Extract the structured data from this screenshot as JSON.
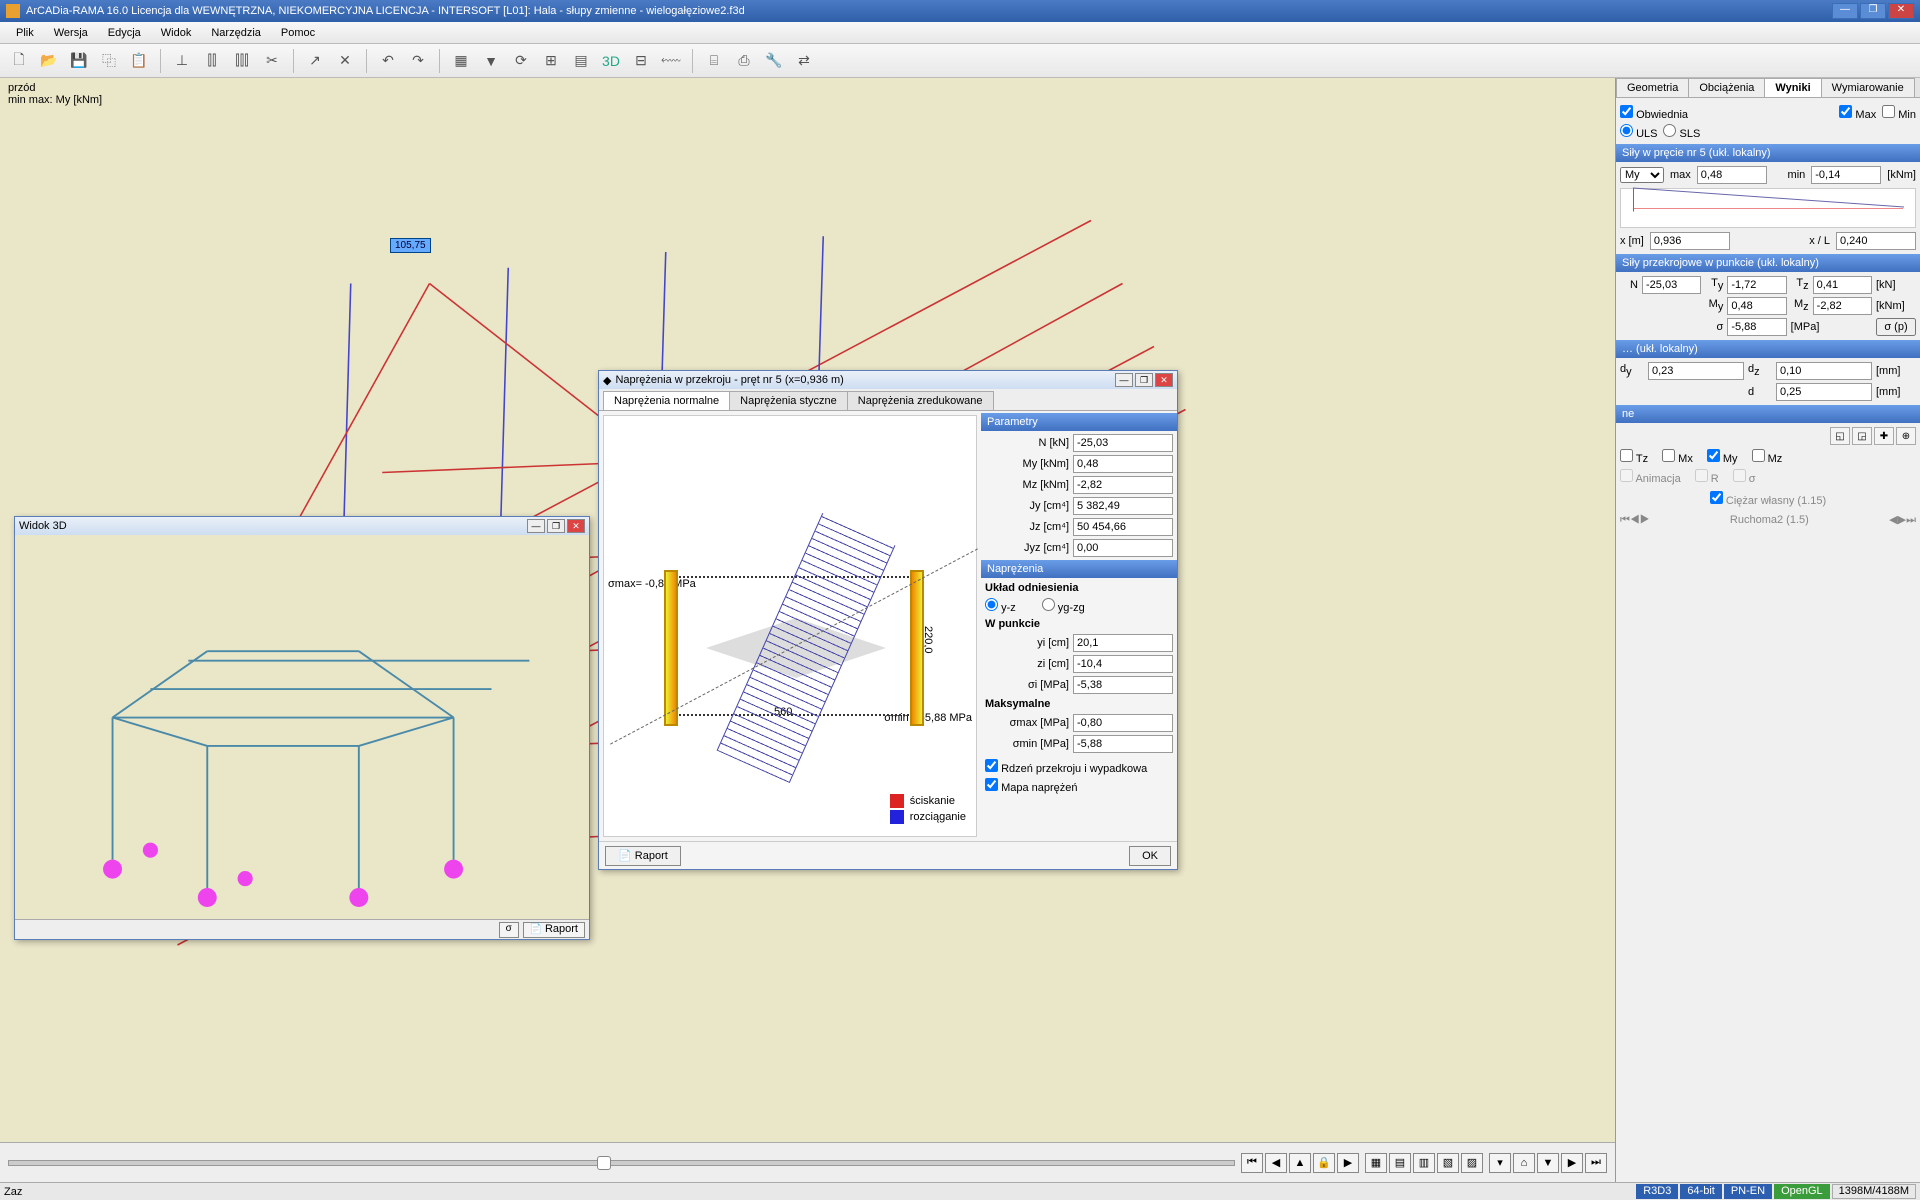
{
  "app": {
    "title": "ArCADia-RAMA 16.0 Licencja dla WEWNĘTRZNA, NIEKOMERCYJNA LICENCJA - INTERSOFT [L01]: Hala - słupy zmienne - wielogałęziowe2.f3d"
  },
  "menubar": [
    "Plik",
    "Wersja",
    "Edycja",
    "Widok",
    "Narzędzia",
    "Pomoc"
  ],
  "canvas": {
    "top_left_1": "przód",
    "top_left_2": "min max: My [kNm]",
    "tag_value": "105,75"
  },
  "panel": {
    "tabs": [
      "Geometria",
      "Obciążenia",
      "Wyniki",
      "Wymiarowanie"
    ],
    "active_tab": 2,
    "obwiednia": "Obwiednia",
    "max_cb": "Max",
    "min_cb": "Min",
    "uls": "ULS",
    "sls": "SLS",
    "sec_forces_header": "Siły w pręcie nr 5 (ukł. lokalny)",
    "force_sel": "My",
    "max_lbl": "max",
    "max_val": "0,48",
    "min_lbl": "min",
    "min_val": "-0,14",
    "unit_knm": "[kNm]",
    "xm_lbl": "x [m]",
    "xm_val": "0,936",
    "xl_lbl": "x / L",
    "xl_val": "0,240",
    "pt_forces_header": "Siły przekrojowe w punkcie (ukł. lokalny)",
    "forces": {
      "N": "-25,03",
      "Ty": "-1,72",
      "Tz": "0,41",
      "My": "0,48",
      "Mz": "-2,82",
      "sigma": "-5,88",
      "sigma_unit": "[MPa]",
      "sigma_btn": "σ (p)",
      "kN": "[kN]",
      "kNm": "[kNm]"
    },
    "disp_header": "… (ukł. lokalny)",
    "disp": {
      "dy": "0,23",
      "dz": "0,10",
      "d": "0,25",
      "unit": "[mm]"
    },
    "anim_header": "ne",
    "anim": {
      "Tz": "Tz",
      "Mx": "Mx",
      "My": "My",
      "Mz": "Mz",
      "Animacja": "Animacja",
      "R": "R",
      "sigma": "σ",
      "ciezar": "Ciężar własny (1.15)",
      "ruchoma": "Ruchoma2 (1.5)"
    }
  },
  "win3d": {
    "title": "Widok 3D",
    "sigma_btn": "σ",
    "raport_btn": "Raport"
  },
  "dlg": {
    "title": "Naprężenia w przekroju - pręt nr 5 (x=0,936 m)",
    "tabs": [
      "Naprężenia normalne",
      "Naprężenia styczne",
      "Naprężenia zredukowane"
    ],
    "active_tab": 0,
    "param_header": "Parametry",
    "params": {
      "N": "-25,03",
      "N_u": "N [kN]",
      "My": "0,48",
      "My_u": "My [kNm]",
      "Mz": "-2,82",
      "Mz_u": "Mz [kNm]",
      "Jy": "5 382,49",
      "Jy_u": "Jy [cm⁴]",
      "Jz": "50 454,66",
      "Jz_u": "Jz [cm⁴]",
      "Jyz": "0,00",
      "Jyz_u": "Jyz [cm⁴]"
    },
    "stress_header": "Naprężenia",
    "ref_lbl": "Układ odniesienia",
    "ref_yz": "y-z",
    "ref_ygzg": "yg-zg",
    "pt_lbl": "W punkcie",
    "pt": {
      "yi": "20,1",
      "yi_u": "yi [cm]",
      "zi": "-10,4",
      "zi_u": "zi [cm]",
      "si": "-5,38",
      "si_u": "σi [MPa]"
    },
    "max_lbl": "Maksymalne",
    "max": {
      "smax": "-0,80",
      "smax_u": "σmax [MPa]",
      "smin": "-5,88",
      "smin_u": "σmin [MPa]"
    },
    "cb1": "Rdzeń przekroju i wypadkowa",
    "cb2": "Mapa naprężeń",
    "raport": "Raport",
    "ok": "OK",
    "sketch": {
      "sigma_max": "σmax= -0,80 MPa",
      "sigma_min": "σmin = -5,88 MPa",
      "legend_comp": "ściskanie",
      "legend_tens": "rozciąganie",
      "dim_w": "560",
      "dim_h": "220,0"
    }
  },
  "status": {
    "left": "Zaz",
    "r3d3": "R3D3",
    "bit": "64-bit",
    "pnen": "PN-EN",
    "ogl": "OpenGL",
    "mem": "1398M/4188M"
  }
}
